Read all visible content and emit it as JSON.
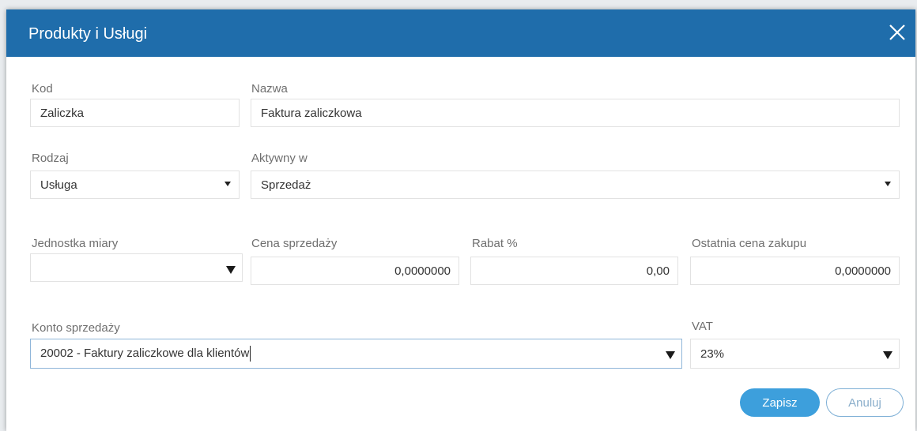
{
  "dialog": {
    "title": "Produkty i Usługi",
    "close_icon": "close-icon"
  },
  "form": {
    "kod": {
      "label": "Kod",
      "value": "Zaliczka"
    },
    "nazwa": {
      "label": "Nazwa",
      "value": "Faktura zaliczkowa"
    },
    "rodzaj": {
      "label": "Rodzaj",
      "value": "Usługa"
    },
    "aktywny_w": {
      "label": "Aktywny w",
      "value": "Sprzedaż"
    },
    "jednostka_miary": {
      "label": "Jednostka miary",
      "value": ""
    },
    "cena_sprzedazy": {
      "label": "Cena sprzedaży",
      "value": "0,0000000"
    },
    "rabat": {
      "label": "Rabat %",
      "value": "0,00"
    },
    "ostatnia_cena_zakupu": {
      "label": "Ostatnia cena zakupu",
      "value": "0,0000000"
    },
    "konto_sprzedazy": {
      "label": "Konto sprzedaży",
      "value": "20002 - Faktury zaliczkowe dla klientów"
    },
    "vat": {
      "label": "VAT",
      "value": "23%"
    }
  },
  "buttons": {
    "save": "Zapisz",
    "cancel": "Anuluj"
  },
  "colors": {
    "header": "#1f6dab",
    "primary_button": "#3d9fdc",
    "secondary_button_border": "#7fb0d6"
  }
}
